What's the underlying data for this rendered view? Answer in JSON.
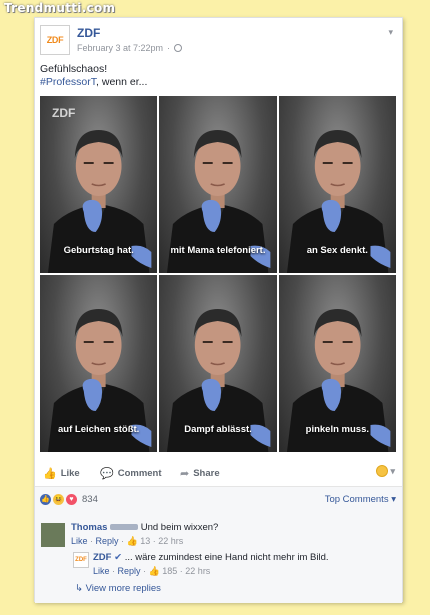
{
  "watermark": "Trendmutti.com",
  "post": {
    "author": "ZDF",
    "avatar_logo": "ZDF",
    "timestamp": "February 3 at 7:22pm",
    "separator": "·",
    "line1": "Gefühlschaos!",
    "hashtag": "#ProfessorT",
    "line2_rest": ", wenn er...",
    "image_watermark": "ZDF",
    "captions": [
      "Geburtstag hat.",
      "mit Mama telefoniert.",
      "an Sex denkt.",
      "auf Leichen stößt.",
      "Dampf ablässt.",
      "pinkeln muss."
    ]
  },
  "actions": {
    "like": "Like",
    "comment": "Comment",
    "share": "Share"
  },
  "stats": {
    "reaction_count": "834",
    "top_comments": "Top Comments"
  },
  "comments": [
    {
      "name": "Thomas",
      "text": "Und beim wixxen?",
      "like": "Like",
      "reply": "Reply",
      "likes": "13",
      "time": "22 hrs"
    },
    {
      "name": "ZDF",
      "text": "... wäre zumindest eine Hand nicht mehr im Bild.",
      "like": "Like",
      "reply": "Reply",
      "likes": "185",
      "time": "22 hrs"
    }
  ],
  "view_more": "View more replies"
}
